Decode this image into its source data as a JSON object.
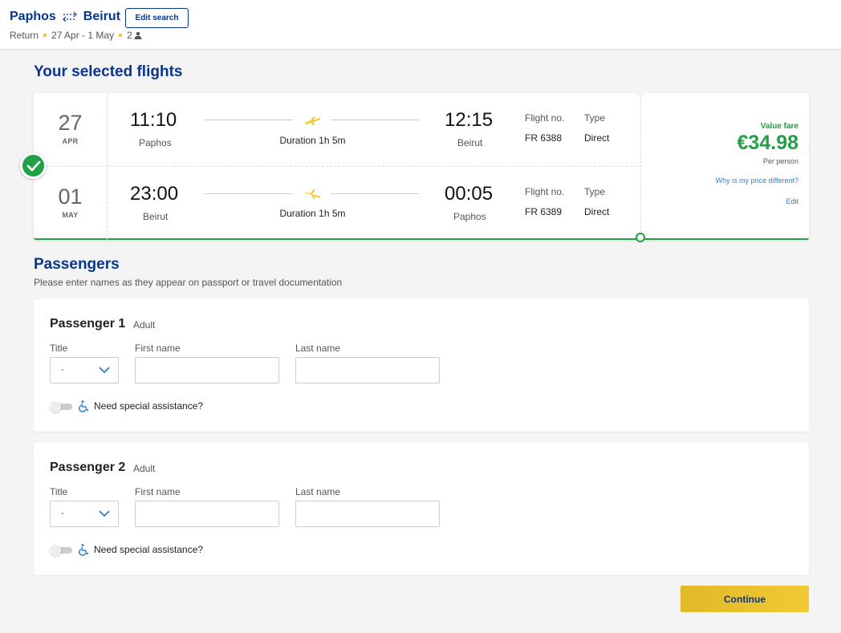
{
  "header": {
    "origin": "Paphos",
    "destination": "Beirut",
    "edit_search_label": "Edit search",
    "trip_type": "Return",
    "dates": "27 Apr - 1 May",
    "passenger_count": "2"
  },
  "selected_flights": {
    "title": "Your selected flights",
    "flights": [
      {
        "day": "27",
        "month": "APR",
        "dep_time": "11:10",
        "dep_city": "Paphos",
        "duration": "Duration 1h 5m",
        "arr_time": "12:15",
        "arr_city": "Beirut",
        "flight_no_label": "Flight no.",
        "flight_no": "FR 6388",
        "type_label": "Type",
        "type": "Direct"
      },
      {
        "day": "01",
        "month": "MAY",
        "dep_time": "23:00",
        "dep_city": "Beirut",
        "duration": "Duration 1h 5m",
        "arr_time": "00:05",
        "arr_city": "Paphos",
        "flight_no_label": "Flight no.",
        "flight_no": "FR 6389",
        "type_label": "Type",
        "type": "Direct"
      }
    ],
    "fare": {
      "name": "Value fare",
      "price": "€34.98",
      "per": "Per person",
      "why_link": "Why is my price different?",
      "edit_link": "Edit"
    }
  },
  "passengers": {
    "title": "Passengers",
    "subtitle": "Please enter names as they appear on passport or travel documentation",
    "list": [
      {
        "heading": "Passenger 1",
        "type": "Adult",
        "title_label": "Title",
        "title_value": "-",
        "first_name_label": "First name",
        "first_name_value": "",
        "last_name_label": "Last name",
        "last_name_value": "",
        "assistance_label": "Need special assistance?"
      },
      {
        "heading": "Passenger 2",
        "type": "Adult",
        "title_label": "Title",
        "title_value": "-",
        "first_name_label": "First name",
        "first_name_value": "",
        "last_name_label": "Last name",
        "last_name_value": "",
        "assistance_label": "Need special assistance?"
      }
    ]
  },
  "continue_label": "Continue",
  "colors": {
    "brand_blue": "#073590",
    "accent_yellow": "#f1c933",
    "success_green": "#21a046",
    "link_blue": "#2f7fd0"
  }
}
